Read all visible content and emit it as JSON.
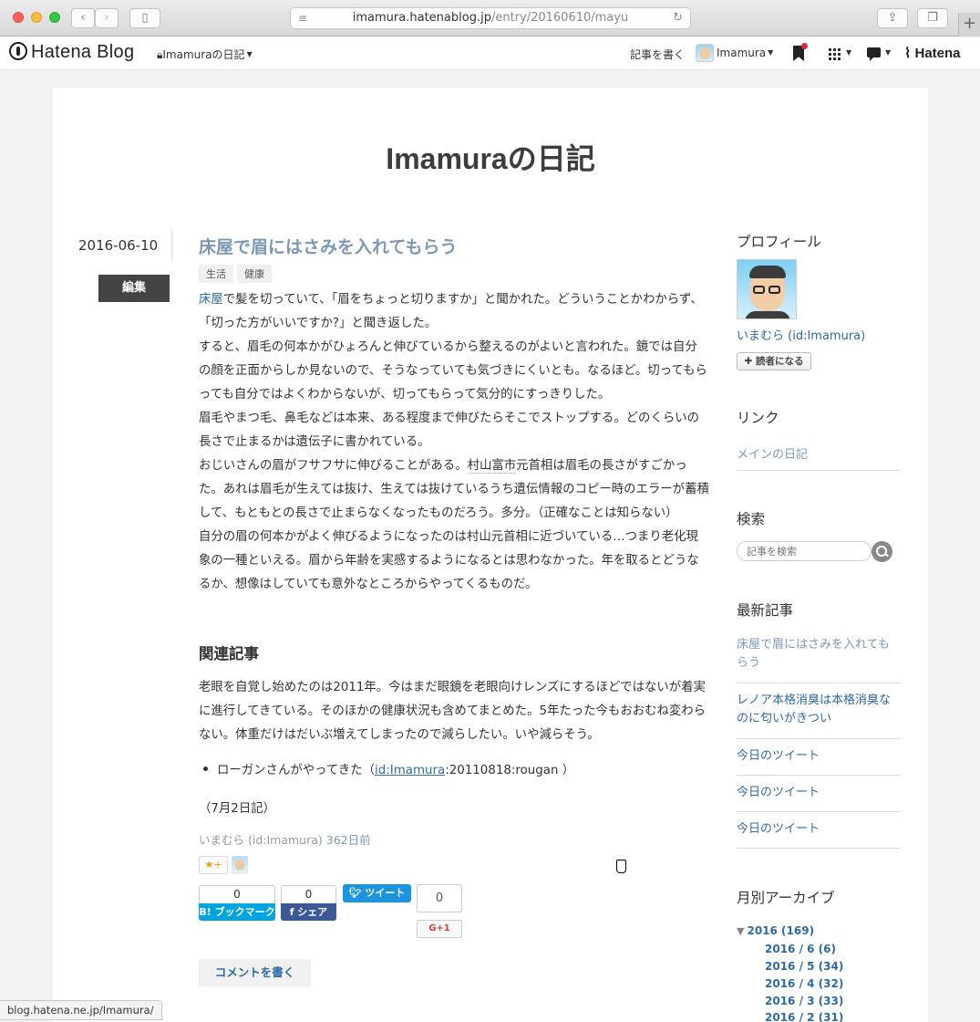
{
  "browser": {
    "url_domain": "imamura.hatenablog.jp",
    "url_path": "/entry/20160610/mayu",
    "reader_icon": "reader-icon",
    "reload_icon": "reload-icon",
    "new_tab_label": "+",
    "status_url": "blog.hatena.ne.jp/Imamura/"
  },
  "header": {
    "logo": "Hatena Blog",
    "blog_select": "Imamuraの日記",
    "write_label": "記事を書く",
    "user_label": "Imamura",
    "hatena_label": "Hatena"
  },
  "blog": {
    "title": "Imamuraの日記"
  },
  "entry": {
    "date": "2016-06-10",
    "edit_label": "編集",
    "title": "床屋で眉にはさみを入れてもらう",
    "categories": [
      "生活",
      "健康"
    ],
    "p1_link": "床屋",
    "p1_rest": "で髪を切っていて、「眉をちょっと切りますか」と聞かれた。どういうことかわからず、「切った方がいいですか?」と聞き返した。",
    "p2": "すると、眉毛の何本かがひょろんと伸びているから整えるのがよいと言われた。鏡では自分の顔を正面からしか見ないので、そうなっていても気づきにくいとも。なるほど。切ってもらっても自分ではよくわからないが、切ってもらって気分的にすっきりした。",
    "p3": "眉毛やまつ毛、鼻毛などは本来、ある程度まで伸びたらそこでストップする。どのくらいの長さで止まるかは遺伝子に書かれている。",
    "p4_pre": "おじいさんの眉がフサフサに伸びることがある。",
    "p4_kw": "村山富市",
    "p4_rest": "元首相は眉毛の長さがすごかった。あれは眉毛が生えては抜け、生えては抜けているうち遺伝情報のコピー時のエラーが蓄積して、もともとの長さで止まらなくなったものだろう。多分。（正確なことは知らない）",
    "p5": "自分の眉の何本かがよく伸びるようになったのは村山元首相に近づいている…つまり老化現象の一種といえる。眉から年齢を実感するようになるとは思わなかった。年を取るとどうなるか、想像はしていても意外なところからやってくるものだ。",
    "related_heading": "関連記事",
    "related_text": "老眼を自覚し始めたのは2011年。今はまだ眼鏡を老眼向けレンズにするほどではないが着実に進行してきている。そのほかの健康状況も含めてまとめた。5年たった今もおおむね変わらない。体重だけはだいぶ増えてしまったので減らしたい。いや減らそう。",
    "related_item_pre": "ローガンさんがやってきた（",
    "related_item_link": "id:Imamura",
    "related_item_post": ":20110818:rougan ）",
    "date_note": "（7月2日記）",
    "author": "いまむら (id:Imamura)",
    "ago": "362日前",
    "star_label": "★+",
    "hatebu_count": "0",
    "hatebu_label": "B! ブックマーク",
    "fb_count": "0",
    "fb_label": "f シェア",
    "tweet_label": "ツイート",
    "gplus_count": "0",
    "gplus_label": "G+1",
    "comment_label": "コメントを書く"
  },
  "sidebar": {
    "profile_heading": "プロフィール",
    "profile_name": "いまむら (id:Imamura)",
    "reader_label": "✚ 読者になる",
    "link_heading": "リンク",
    "link_main": "メインの日記",
    "search_heading": "検索",
    "search_placeholder": "記事を検索",
    "recent_heading": "最新記事",
    "recent": [
      "床屋で眉にはさみを入れてもらう",
      "レノア本格消臭は本格消臭なのに匂いがきつい",
      "今日のツイート",
      "今日のツイート",
      "今日のツイート"
    ],
    "archive_heading": "月別アーカイブ",
    "archive_year": "2016 (169)",
    "archive_months": [
      "2016 / 6 (6)",
      "2016 / 5 (34)",
      "2016 / 4 (32)",
      "2016 / 3 (33)",
      "2016 / 2 (31)"
    ]
  }
}
